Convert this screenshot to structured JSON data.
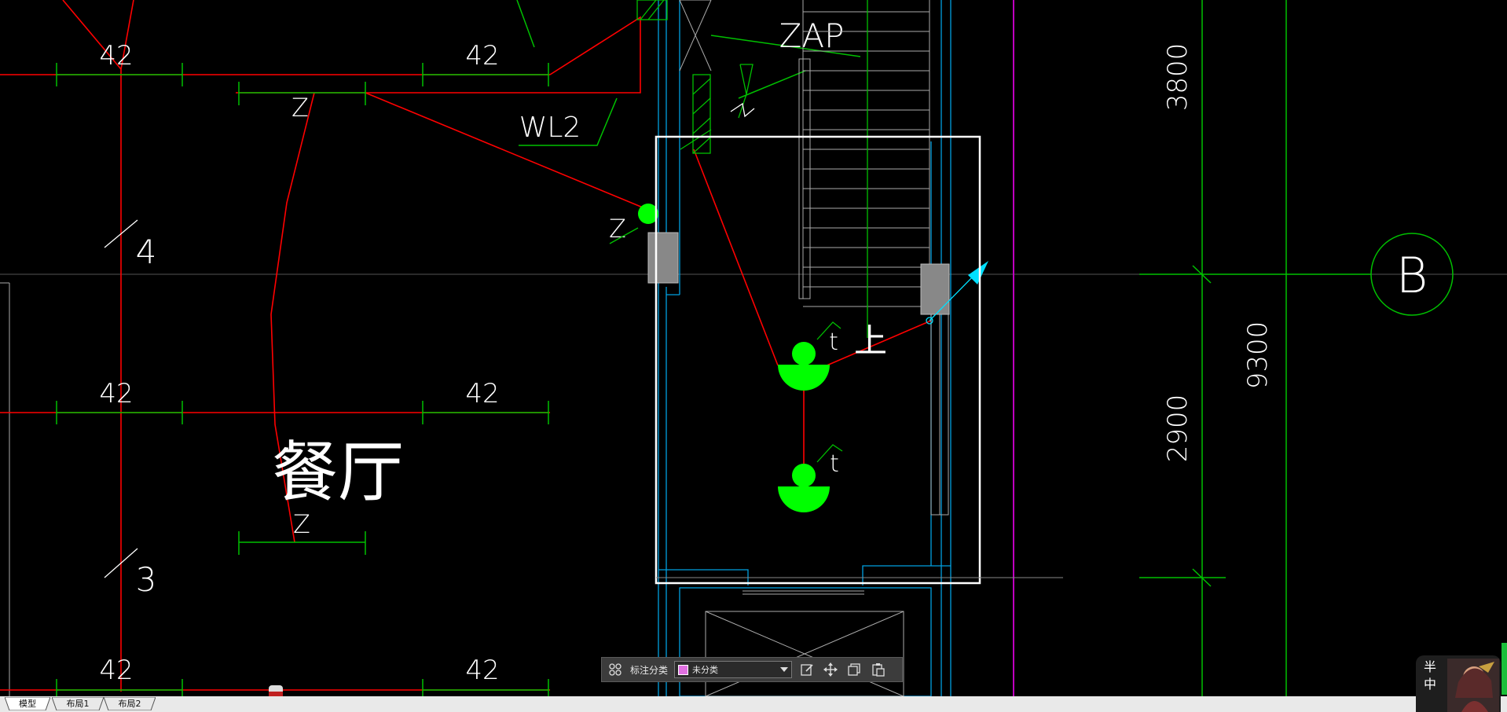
{
  "drawing": {
    "room_label": "餐厅",
    "dim_labels": [
      "42",
      "42",
      "42",
      "42",
      "42",
      "42"
    ],
    "circuit_labels": [
      "WL2",
      "ZAP"
    ],
    "marker_labels": [
      "Z",
      "Z",
      "Z"
    ],
    "slash_labels": [
      "4",
      "3"
    ],
    "lamp_labels": [
      "t",
      "t"
    ],
    "stair_label": "上",
    "axis_bubble": "B",
    "vertical_dims": [
      "3800",
      "9300",
      "2900"
    ]
  },
  "toolbar": {
    "category_label": "标注分类",
    "category_value": "未分类",
    "category_color": "#e070e0",
    "icons": [
      "grid-icon",
      "edit-icon",
      "move-icon",
      "copy-icon",
      "paste-icon"
    ]
  },
  "tabs": [
    {
      "label": "模型",
      "active": true
    },
    {
      "label": "布局1",
      "active": false
    },
    {
      "label": "布局2",
      "active": false
    }
  ],
  "assistant": {
    "chars": "半\n中"
  },
  "colors": {
    "background": "#000000",
    "wire_red": "#ff0000",
    "grid_green": "#00c000",
    "lamp_green": "#00ff00",
    "wall_cyan": "#00a0e0",
    "selection_white": "#ffffff",
    "axis_magenta": "#c000c0"
  }
}
